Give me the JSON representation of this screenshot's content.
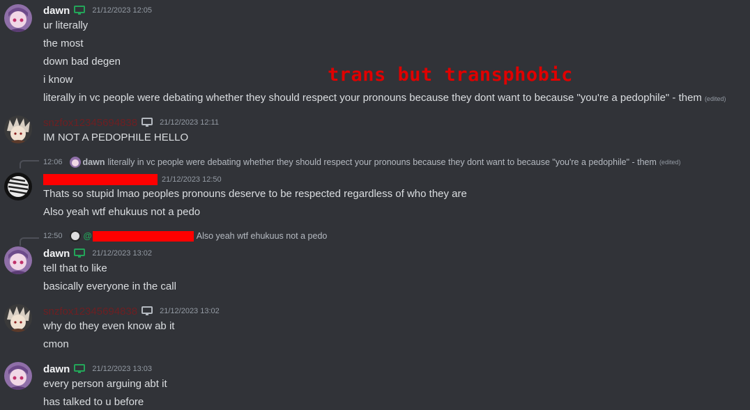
{
  "overlay": {
    "caption": "trans but transphobic"
  },
  "groups": [
    {
      "username": "dawn",
      "timestamp": "21/12/2023 12:05",
      "lines": [
        "ur literally",
        "the most",
        "down bad degen",
        "i know",
        "literally in vc people were debating whether they should respect your pronouns because they dont want to because \"you're a pedophile\" - them"
      ],
      "edited_label": "(edited)"
    },
    {
      "username": "snzfox12345694838",
      "timestamp": "21/12/2023 12:11",
      "lines": [
        "IM NOT A PEDOPHILE HELLO"
      ]
    },
    {
      "reply": {
        "time": "12:06",
        "name": "dawn",
        "text": "literally in vc people were debating whether they should respect your pronouns because they dont want to because \"you're a pedophile\" - them",
        "edited_label": "(edited)"
      },
      "timestamp": "21/12/2023 12:50",
      "lines": [
        "Thats so stupid lmao peoples pronouns deserve to be respected regardless of who they are",
        "Also yeah wtf ehukuus not a pedo"
      ]
    },
    {
      "reply": {
        "time": "12:50",
        "mention_prefix": "@",
        "text": "Also yeah wtf ehukuus not a pedo"
      },
      "username": "dawn",
      "timestamp": "21/12/2023 13:02",
      "lines": [
        "tell that to like",
        "basically everyone in the call"
      ]
    },
    {
      "username": "snzfox12345694838",
      "timestamp": "21/12/2023 13:02",
      "lines": [
        "why do they even know ab it",
        "cmon"
      ]
    },
    {
      "username": "dawn",
      "timestamp": "21/12/2023 13:03",
      "lines": [
        "every person arguing abt it",
        "has talked to u before"
      ]
    }
  ],
  "colors": {
    "background": "#313338",
    "redaction": "#ff0000",
    "device_icon_green": "#23a559",
    "device_icon_gray": "#b5bac1"
  },
  "icons": {
    "device": "desktop-icon"
  }
}
